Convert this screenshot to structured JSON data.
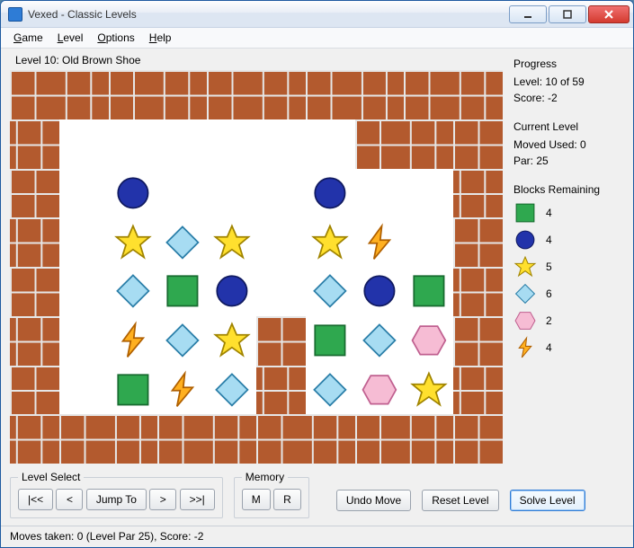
{
  "window": {
    "title": "Vexed - Classic Levels"
  },
  "menubar": {
    "items": [
      "Game",
      "Level",
      "Options",
      "Help"
    ]
  },
  "level_title": "Level 10: Old Brown Shoe",
  "progress": {
    "heading": "Progress",
    "level_label": "Level: 10 of 59",
    "score_label": "Score: -2"
  },
  "current_level": {
    "heading": "Current Level",
    "moves_label": "Moved Used: 0",
    "par_label": "Par: 25"
  },
  "blocks_remaining": {
    "heading": "Blocks Remaining",
    "items": [
      {
        "piece": "square",
        "count": 4
      },
      {
        "piece": "circle",
        "count": 4
      },
      {
        "piece": "star",
        "count": 5
      },
      {
        "piece": "diamond",
        "count": 6
      },
      {
        "piece": "hexagon",
        "count": 2
      },
      {
        "piece": "bolt",
        "count": 4
      }
    ]
  },
  "level_select": {
    "heading": "Level Select",
    "first": "|<<",
    "prev": "<",
    "jump": "Jump To",
    "next": ">",
    "last": ">>|"
  },
  "memory": {
    "heading": "Memory",
    "m": "M",
    "r": "R"
  },
  "actions": {
    "undo": "Undo Move",
    "reset": "Reset Level",
    "solve": "Solve Level"
  },
  "statusbar": "Moves taken: 0 (Level Par 25), Score: -2",
  "board": {
    "rows": 8,
    "cols": 10,
    "cells": [
      [
        "W",
        "W",
        "W",
        "W",
        "W",
        "W",
        "W",
        "W",
        "W",
        "W"
      ],
      [
        "W",
        ".",
        ".",
        ".",
        ".",
        ".",
        ".",
        "W",
        "W",
        "W"
      ],
      [
        "W",
        ".",
        "C",
        ".",
        ".",
        ".",
        "C",
        ".",
        ".",
        "W"
      ],
      [
        "W",
        ".",
        "Y",
        "D",
        "Y",
        ".",
        "Y",
        "B",
        ".",
        "W"
      ],
      [
        "W",
        ".",
        "D",
        "S",
        "C",
        ".",
        "D",
        "C",
        "S",
        "W"
      ],
      [
        "W",
        ".",
        "B",
        "D",
        "Y",
        "W",
        "S",
        "D",
        "H",
        "W"
      ],
      [
        "W",
        ".",
        "S",
        "B",
        "D",
        "W",
        "D",
        "H",
        "Y",
        "W"
      ],
      [
        "W",
        "W",
        "W",
        "W",
        "W",
        "W",
        "W",
        "W",
        "W",
        "W"
      ]
    ],
    "legend": {
      "W": "wall",
      ".": "empty",
      "C": "circle",
      "S": "square",
      "Y": "star",
      "D": "diamond",
      "H": "hexagon",
      "B": "bolt"
    }
  },
  "colors": {
    "square": "#2fa84f",
    "circle": "#2233aa",
    "star_fill": "#ffe02e",
    "star_stroke": "#a08400",
    "diamond_fill": "#a7dcf2",
    "diamond_stroke": "#2a7ea8",
    "hexagon_fill": "#f6bcd4",
    "hexagon_stroke": "#c06090",
    "bolt_fill": "#ffb020",
    "bolt_stroke": "#b06000"
  }
}
